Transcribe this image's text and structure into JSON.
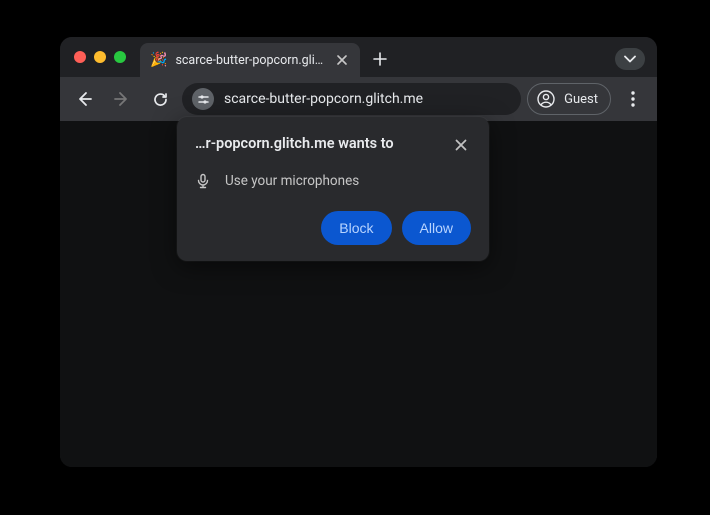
{
  "tab": {
    "favicon": "🎉",
    "title": "scarce-butter-popcorn.glitch"
  },
  "toolbar": {
    "url": "scarce-butter-popcorn.glitch.me",
    "guest_label": "Guest"
  },
  "dialog": {
    "title": "…r-popcorn.glitch.me wants to",
    "permission_label": "Use your microphones",
    "block_label": "Block",
    "allow_label": "Allow"
  }
}
